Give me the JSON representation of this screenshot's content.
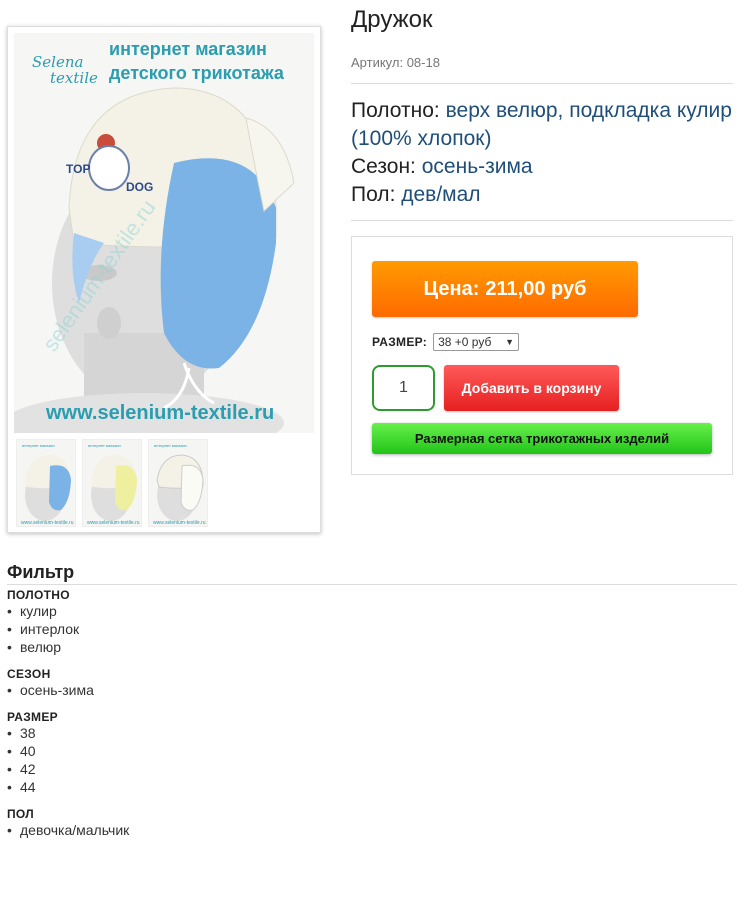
{
  "product": {
    "title": "Дружок",
    "sku_label": "Артикул:",
    "sku_value": "08-18",
    "props": [
      {
        "label": "Полотно:",
        "value": "верх велюр, подкладка кулир (100% хлопок)"
      },
      {
        "label": "Сезон:",
        "value": "осень-зима"
      },
      {
        "label": "Пол:",
        "value": "дев/мал"
      }
    ]
  },
  "image": {
    "logo_line1": "Selena",
    "logo_line2": "textile",
    "header_line1": "интернет магазин",
    "header_line2": "детского трикотажа",
    "website": "www.selenium-textile.ru",
    "thumbnail_count": 3
  },
  "buy": {
    "price_label": "Цена:",
    "price_value": "211,00 руб",
    "size_label": "РАЗМЕР:",
    "size_selected": "38 +0 руб",
    "quantity": "1",
    "add_to_cart": "Добавить в корзину",
    "size_chart": "Размерная сетка трикотажных изделий"
  },
  "filter": {
    "title": "Фильтр",
    "groups": [
      {
        "title": "ПОЛОТНО",
        "items": [
          "кулир",
          "интерлок",
          "велюр"
        ]
      },
      {
        "title": "СЕЗОН",
        "items": [
          "осень-зима"
        ]
      },
      {
        "title": "РАЗМЕР",
        "items": [
          "38",
          "40",
          "42",
          "44"
        ]
      },
      {
        "title": "ПОЛ",
        "items": [
          "девочка/мальчик"
        ]
      }
    ]
  },
  "colors": {
    "price_button": "#ff7a00",
    "cart_button": "#ee2a2a",
    "sizechart_button": "#3fd92a",
    "link_value": "#1f4e79",
    "hat_blue": "#7bb3e6",
    "hat_white": "#f4f2e6",
    "hat_yellow": "#eef0a0"
  }
}
